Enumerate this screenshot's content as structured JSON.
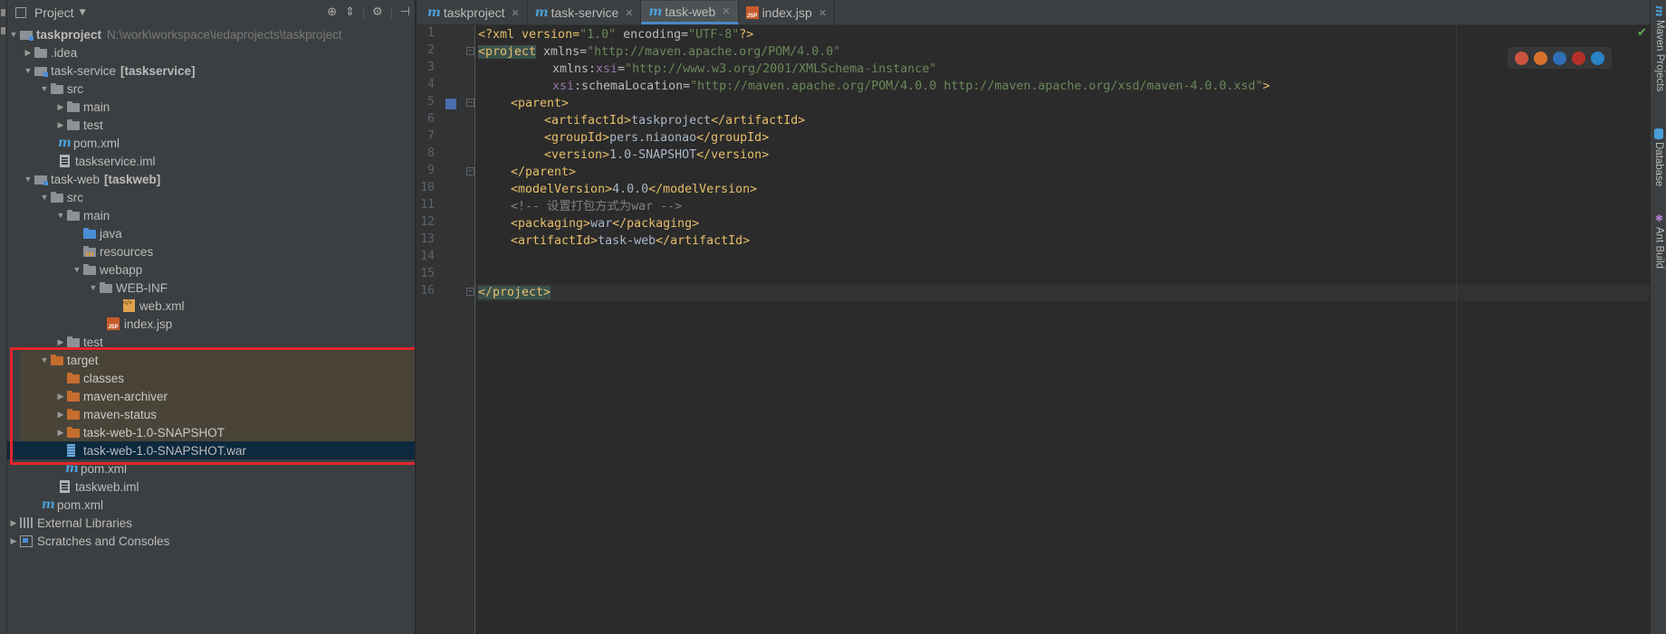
{
  "project_panel": {
    "title": "Project",
    "tree": [
      {
        "label": "taskproject",
        "path": "N:\\work\\workspace\\iedaprojects\\taskproject",
        "bold": true
      },
      {
        "label": ".idea"
      },
      {
        "label": "task-service",
        "tag": "[taskservice]"
      },
      {
        "label": "src"
      },
      {
        "label": "main"
      },
      {
        "label": "test"
      },
      {
        "label": "pom.xml"
      },
      {
        "label": "taskservice.iml"
      },
      {
        "label": "task-web",
        "tag": "[taskweb]"
      },
      {
        "label": "src"
      },
      {
        "label": "main"
      },
      {
        "label": "java"
      },
      {
        "label": "resources"
      },
      {
        "label": "webapp"
      },
      {
        "label": "WEB-INF"
      },
      {
        "label": "web.xml"
      },
      {
        "label": "index.jsp"
      },
      {
        "label": "test"
      },
      {
        "label": "target"
      },
      {
        "label": "classes"
      },
      {
        "label": "maven-archiver"
      },
      {
        "label": "maven-status"
      },
      {
        "label": "task-web-1.0-SNAPSHOT"
      },
      {
        "label": "task-web-1.0-SNAPSHOT.war"
      },
      {
        "label": "pom.xml"
      },
      {
        "label": "taskweb.iml"
      },
      {
        "label": "pom.xml"
      },
      {
        "label": "External Libraries"
      },
      {
        "label": "Scratches and Consoles"
      }
    ]
  },
  "editor": {
    "tabs": [
      {
        "label": "taskproject"
      },
      {
        "label": "task-service"
      },
      {
        "label": "task-web",
        "active": true
      },
      {
        "label": "index.jsp"
      }
    ],
    "line_numbers": [
      "1",
      "2",
      "3",
      "4",
      "5",
      "6",
      "7",
      "8",
      "9",
      "10",
      "11",
      "12",
      "13",
      "14",
      "15",
      "16"
    ],
    "code": {
      "l1_open": "<?xml version=",
      "l1_v1": "\"1.0\"",
      "l1_mid": " encoding=",
      "l1_v2": "\"UTF-8\"",
      "l1_close": "?>",
      "l2_tag": "<project",
      "l2_attr": " xmlns=",
      "l2_val": "\"http://maven.apache.org/POM/4.0.0\"",
      "l3_attr": "xmlns:",
      "l3_ns": "xsi",
      "l3_eq": "=",
      "l3_val": "\"http://www.w3.org/2001/XMLSchema-instance\"",
      "l4_ns": "xsi",
      "l4_attr": ":schemaLocation=",
      "l4_val": "\"http://maven.apache.org/POM/4.0.0 http://maven.apache.org/xsd/maven-4.0.0.xsd\"",
      "l4_close": ">",
      "l5": "<parent>",
      "l6_open": "<artifactId>",
      "l6_text": "taskproject",
      "l6_close": "</artifactId>",
      "l7_open": "<groupId>",
      "l7_text": "pers.niaonao",
      "l7_close": "</groupId>",
      "l8_open": "<version>",
      "l8_text": "1.0-SNAPSHOT",
      "l8_close": "</version>",
      "l9": "</parent>",
      "l10_open": "<modelVersion>",
      "l10_text": "4.0.0",
      "l10_close": "</modelVersion>",
      "l11": "<!-- 设置打包方式为war -->",
      "l12_open": "<packaging>",
      "l12_text": "war",
      "l12_close": "</packaging>",
      "l13_open": "<artifactId>",
      "l13_text": "task-web",
      "l13_close": "</artifactId>",
      "l16": "</project>"
    }
  },
  "right_strip": {
    "maven_projects": "Maven Projects",
    "database": "Database",
    "ant_build": "Ant Build"
  },
  "colors": {
    "highlight_border": "#e0282c",
    "selection": "#0d293e",
    "tag": "#e8bf6a",
    "string": "#6a8759"
  }
}
